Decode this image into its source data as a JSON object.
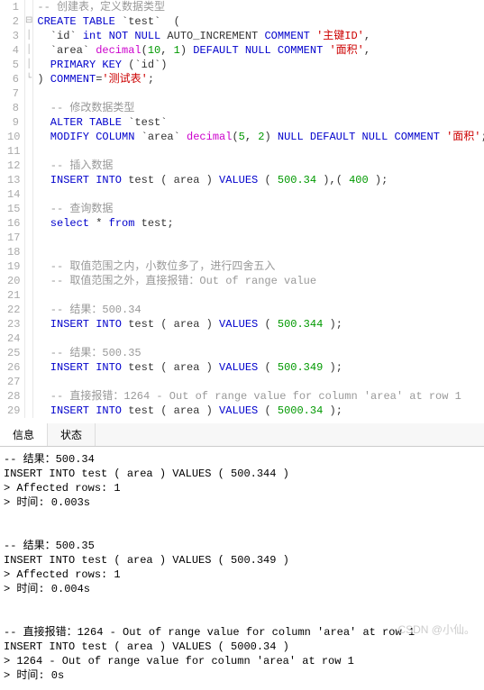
{
  "editor": {
    "lines": [
      {
        "n": 1,
        "fold": "",
        "segs": [
          {
            "t": "-- 创建表，定义数据类型",
            "c": "c-comment"
          }
        ]
      },
      {
        "n": 2,
        "fold": "⊟",
        "segs": [
          {
            "t": "CREATE TABLE",
            "c": "c-keyword"
          },
          {
            "t": " `test`  (",
            "c": "c-plain"
          }
        ]
      },
      {
        "n": 3,
        "fold": "│",
        "segs": [
          {
            "t": "  `id` ",
            "c": "c-plain"
          },
          {
            "t": "int NOT NULL",
            "c": "c-type"
          },
          {
            "t": " AUTO_INCREMENT ",
            "c": "c-plain"
          },
          {
            "t": "COMMENT",
            "c": "c-keyword"
          },
          {
            "t": " ",
            "c": "c-plain"
          },
          {
            "t": "'主键ID'",
            "c": "c-str"
          },
          {
            "t": ",",
            "c": "c-plain"
          }
        ]
      },
      {
        "n": 4,
        "fold": "│",
        "segs": [
          {
            "t": "  `area` ",
            "c": "c-plain"
          },
          {
            "t": "decimal",
            "c": "c-func"
          },
          {
            "t": "(",
            "c": "c-plain"
          },
          {
            "t": "10",
            "c": "c-num"
          },
          {
            "t": ", ",
            "c": "c-plain"
          },
          {
            "t": "1",
            "c": "c-num"
          },
          {
            "t": ") ",
            "c": "c-plain"
          },
          {
            "t": "DEFAULT NULL COMMENT",
            "c": "c-keyword"
          },
          {
            "t": " ",
            "c": "c-plain"
          },
          {
            "t": "'面积'",
            "c": "c-str"
          },
          {
            "t": ",",
            "c": "c-plain"
          }
        ]
      },
      {
        "n": 5,
        "fold": "│",
        "segs": [
          {
            "t": "  ",
            "c": "c-plain"
          },
          {
            "t": "PRIMARY KEY",
            "c": "c-keyword"
          },
          {
            "t": " (`id`)",
            "c": "c-plain"
          }
        ]
      },
      {
        "n": 6,
        "fold": "└",
        "segs": [
          {
            "t": ") ",
            "c": "c-plain"
          },
          {
            "t": "COMMENT",
            "c": "c-keyword"
          },
          {
            "t": "=",
            "c": "c-plain"
          },
          {
            "t": "'测试表'",
            "c": "c-str"
          },
          {
            "t": ";",
            "c": "c-plain"
          }
        ]
      },
      {
        "n": 7,
        "fold": "",
        "segs": []
      },
      {
        "n": 8,
        "fold": "",
        "segs": [
          {
            "t": "  -- 修改数据类型",
            "c": "c-comment"
          }
        ]
      },
      {
        "n": 9,
        "fold": "",
        "segs": [
          {
            "t": "  ",
            "c": "c-plain"
          },
          {
            "t": "ALTER TABLE",
            "c": "c-keyword"
          },
          {
            "t": " `test`",
            "c": "c-plain"
          }
        ]
      },
      {
        "n": 10,
        "fold": "",
        "segs": [
          {
            "t": "  ",
            "c": "c-plain"
          },
          {
            "t": "MODIFY COLUMN",
            "c": "c-keyword"
          },
          {
            "t": " `area` ",
            "c": "c-plain"
          },
          {
            "t": "decimal",
            "c": "c-func"
          },
          {
            "t": "(",
            "c": "c-plain"
          },
          {
            "t": "5",
            "c": "c-num"
          },
          {
            "t": ", ",
            "c": "c-plain"
          },
          {
            "t": "2",
            "c": "c-num"
          },
          {
            "t": ") ",
            "c": "c-plain"
          },
          {
            "t": "NULL DEFAULT NULL COMMENT",
            "c": "c-keyword"
          },
          {
            "t": " ",
            "c": "c-plain"
          },
          {
            "t": "'面积'",
            "c": "c-str"
          },
          {
            "t": ";",
            "c": "c-plain"
          }
        ]
      },
      {
        "n": 11,
        "fold": "",
        "segs": []
      },
      {
        "n": 12,
        "fold": "",
        "segs": [
          {
            "t": "  -- 插入数据",
            "c": "c-comment"
          }
        ]
      },
      {
        "n": 13,
        "fold": "",
        "segs": [
          {
            "t": "  ",
            "c": "c-plain"
          },
          {
            "t": "INSERT INTO",
            "c": "c-keyword"
          },
          {
            "t": " test ( area ) ",
            "c": "c-plain"
          },
          {
            "t": "VALUES",
            "c": "c-keyword"
          },
          {
            "t": " ( ",
            "c": "c-plain"
          },
          {
            "t": "500.34",
            "c": "c-num"
          },
          {
            "t": " ),( ",
            "c": "c-plain"
          },
          {
            "t": "400",
            "c": "c-num"
          },
          {
            "t": " );",
            "c": "c-plain"
          }
        ]
      },
      {
        "n": 14,
        "fold": "",
        "segs": []
      },
      {
        "n": 15,
        "fold": "",
        "segs": [
          {
            "t": "  -- 查询数据",
            "c": "c-comment"
          }
        ]
      },
      {
        "n": 16,
        "fold": "",
        "segs": [
          {
            "t": "  ",
            "c": "c-plain"
          },
          {
            "t": "select",
            "c": "c-keyword"
          },
          {
            "t": " * ",
            "c": "c-plain"
          },
          {
            "t": "from",
            "c": "c-keyword"
          },
          {
            "t": " test;",
            "c": "c-plain"
          }
        ]
      },
      {
        "n": 17,
        "fold": "",
        "segs": []
      },
      {
        "n": 18,
        "fold": "",
        "segs": []
      },
      {
        "n": 19,
        "fold": "",
        "segs": [
          {
            "t": "  -- 取值范围之内，小数位多了，进行四舍五入",
            "c": "c-comment"
          }
        ]
      },
      {
        "n": 20,
        "fold": "",
        "segs": [
          {
            "t": "  -- 取值范围之外，直接报错：Out of range value",
            "c": "c-comment"
          }
        ]
      },
      {
        "n": 21,
        "fold": "",
        "segs": []
      },
      {
        "n": 22,
        "fold": "",
        "segs": [
          {
            "t": "  -- 结果：500.34",
            "c": "c-comment"
          }
        ]
      },
      {
        "n": 23,
        "fold": "",
        "segs": [
          {
            "t": "  ",
            "c": "c-plain"
          },
          {
            "t": "INSERT INTO",
            "c": "c-keyword"
          },
          {
            "t": " test ( area ) ",
            "c": "c-plain"
          },
          {
            "t": "VALUES",
            "c": "c-keyword"
          },
          {
            "t": " ( ",
            "c": "c-plain"
          },
          {
            "t": "500.344",
            "c": "c-num"
          },
          {
            "t": " );",
            "c": "c-plain"
          }
        ]
      },
      {
        "n": 24,
        "fold": "",
        "segs": []
      },
      {
        "n": 25,
        "fold": "",
        "segs": [
          {
            "t": "  -- 结果：500.35",
            "c": "c-comment"
          }
        ]
      },
      {
        "n": 26,
        "fold": "",
        "segs": [
          {
            "t": "  ",
            "c": "c-plain"
          },
          {
            "t": "INSERT INTO",
            "c": "c-keyword"
          },
          {
            "t": " test ( area ) ",
            "c": "c-plain"
          },
          {
            "t": "VALUES",
            "c": "c-keyword"
          },
          {
            "t": " ( ",
            "c": "c-plain"
          },
          {
            "t": "500.349",
            "c": "c-num"
          },
          {
            "t": " );",
            "c": "c-plain"
          }
        ]
      },
      {
        "n": 27,
        "fold": "",
        "segs": []
      },
      {
        "n": 28,
        "fold": "",
        "segs": [
          {
            "t": "  -- 直接报错：1264 - Out of range value for column 'area' at row 1",
            "c": "c-comment"
          }
        ]
      },
      {
        "n": 29,
        "fold": "",
        "segs": [
          {
            "t": "  ",
            "c": "c-plain"
          },
          {
            "t": "INSERT INTO",
            "c": "c-keyword"
          },
          {
            "t": " test ( area ) ",
            "c": "c-plain"
          },
          {
            "t": "VALUES",
            "c": "c-keyword"
          },
          {
            "t": " ( ",
            "c": "c-plain"
          },
          {
            "t": "5000.34",
            "c": "c-num"
          },
          {
            "t": " );",
            "c": "c-plain"
          }
        ]
      }
    ]
  },
  "tabs": {
    "info": "信息",
    "state": "状态"
  },
  "output": "-- 结果：500.34\nINSERT INTO test ( area ) VALUES ( 500.344 )\n> Affected rows: 1\n> 时间: 0.003s\n\n\n-- 结果：500.35\nINSERT INTO test ( area ) VALUES ( 500.349 )\n> Affected rows: 1\n> 时间: 0.004s\n\n\n-- 直接报错：1264 - Out of range value for column 'area' at row 1\nINSERT INTO test ( area ) VALUES ( 5000.34 )\n> 1264 - Out of range value for column 'area' at row 1\n> 时间: 0s",
  "watermark": "CSDN @小仙。"
}
